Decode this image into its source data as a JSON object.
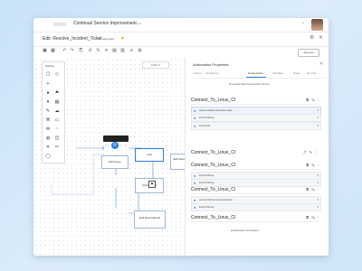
{
  "app": {
    "title": "Continual Service Improvement",
    "pill": "Automate"
  },
  "page": {
    "edit_title": "Edit: Resolve_Incident_Ticket",
    "version": "V4 - approved",
    "approve_label": "Approve"
  },
  "canvas": {
    "zoom": "100% ▾",
    "palette_title": "Actions",
    "nodes": {
      "n1": "Edit Issue",
      "n2": "Link",
      "n3": "Edit Result Email",
      "n4": "Change PM",
      "n5": "Edit Result Email"
    }
  },
  "panel": {
    "title": "Automation Properties",
    "tabs": [
      "Actions",
      "Definitions",
      "Connections",
      "Variables",
      "Notes",
      "Run Ids"
    ],
    "create_group": "Create New Connection Group",
    "groups": [
      {
        "title": "Connect_To_Linux_CI",
        "rows": [
          "connect default.connection.name",
          "Fetch F.N9 key",
          "Fetch F.N4"
        ]
      },
      {
        "title": "Connect_To_Linux_CI",
        "rows": []
      },
      {
        "title": "Connect_To_Linux_CI",
        "rows": [
          "Fetch F.N0 key",
          "Fetch F.N9 key"
        ]
      },
      {
        "title": "Connect_To_Linux_CI",
        "rows": [
          "connect discovery.connection.live",
          "Fetch F.N4 key"
        ]
      },
      {
        "title": "Connect_To_Linux_CI",
        "rows": []
      }
    ],
    "add_connection": "Add New Connection"
  }
}
